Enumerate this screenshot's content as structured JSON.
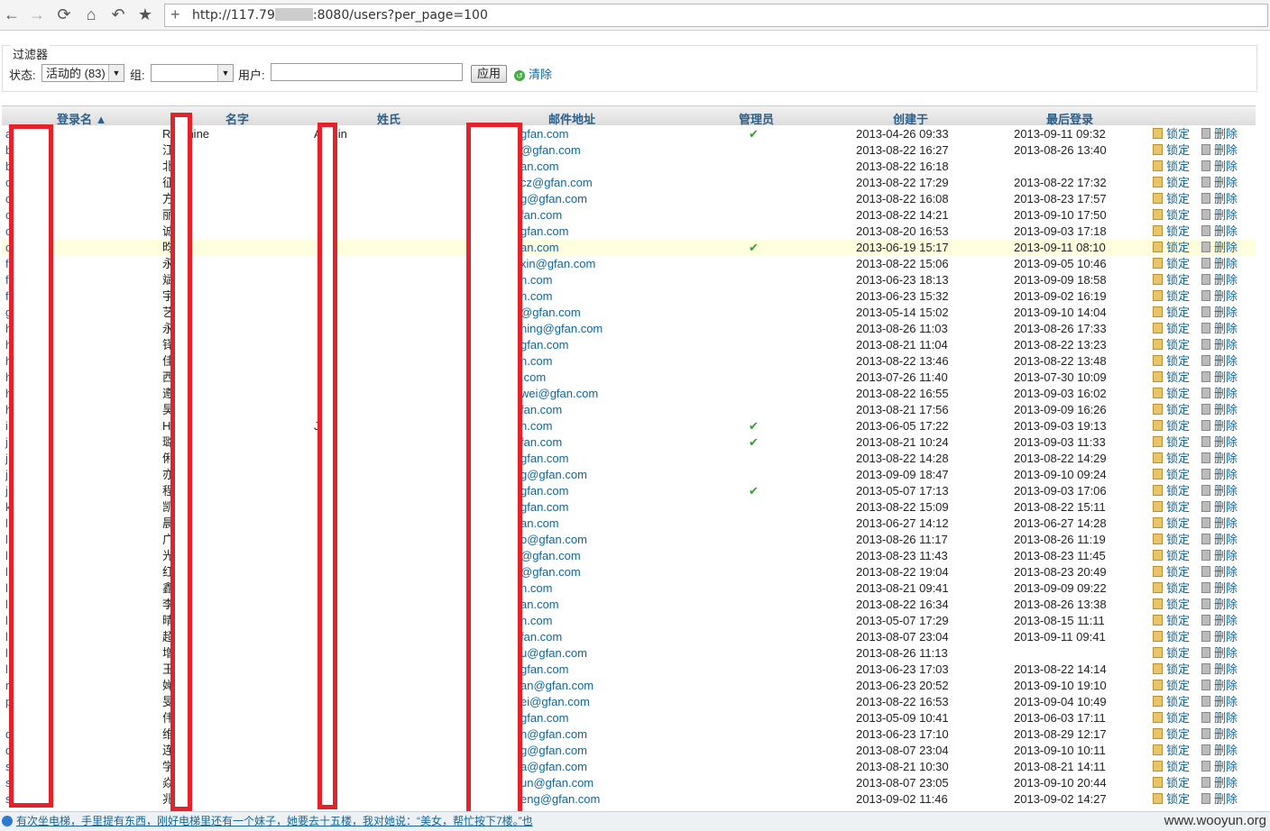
{
  "browser": {
    "url_prefix": "http://117.79",
    "url_suffix": ":8080/users?per_page=100",
    "new_tab": "+",
    "back_icon": "←",
    "forward_icon": "→",
    "reload_icon": "⟳",
    "home_icon": "⌂",
    "undo_icon": "↶",
    "star_icon": "★"
  },
  "filters": {
    "legend": "过滤器",
    "status_label": "状态:",
    "status_value": "活动的 (83)",
    "group_label": "组:",
    "group_value": "",
    "user_label": "用户:",
    "apply": "应用",
    "clear": "清除"
  },
  "table": {
    "headers": [
      "登录名 ▲",
      "名字",
      "姓氏",
      "邮件地址",
      "管理员",
      "创建于",
      "最后登录"
    ],
    "lock_label": "锁定",
    "delete_label": "删除",
    "rows": [
      {
        "login": "a",
        "name": "Redmine",
        "last": "Admin",
        "mail": "gfan.com",
        "admin": "✔",
        "created": "2013-04-26 09:33",
        "lastlog": "2013-09-11 09:32"
      },
      {
        "login": "b",
        "name": "江",
        "last": "",
        "mail": "@gfan.com",
        "admin": "",
        "created": "2013-08-22 16:27",
        "lastlog": "2013-08-26 13:40"
      },
      {
        "login": "b",
        "name": "北",
        "last": "",
        "mail": "an.com",
        "admin": "",
        "created": "2013-08-22 16:18",
        "lastlog": ""
      },
      {
        "login": "c",
        "name": "征",
        "last": "",
        "mail": "cz@gfan.com",
        "admin": "",
        "created": "2013-08-22 17:29",
        "lastlog": "2013-08-22 17:32"
      },
      {
        "login": "c",
        "name": "方",
        "last": "",
        "mail": "g@gfan.com",
        "admin": "",
        "created": "2013-08-22 16:08",
        "lastlog": "2013-08-23 17:57"
      },
      {
        "login": "c",
        "name": "丽",
        "last": "",
        "mail": "fan.com",
        "admin": "",
        "created": "2013-08-22 14:21",
        "lastlog": "2013-09-10 17:50"
      },
      {
        "login": "c",
        "name": "诚",
        "last": "",
        "mail": "gfan.com",
        "admin": "",
        "created": "2013-08-20 16:53",
        "lastlog": "2013-09-03 17:18"
      },
      {
        "login": "c",
        "name": "昀",
        "last": "",
        "mail": "an.com",
        "admin": "✔",
        "created": "2013-06-19 15:17",
        "lastlog": "2013-09-11 08:10"
      },
      {
        "login": "f",
        "name": "永",
        "last": "",
        "mail": "xin@gfan.com",
        "admin": "",
        "created": "2013-08-22 15:06",
        "lastlog": "2013-09-05 10:46"
      },
      {
        "login": "f",
        "name": "斌",
        "last": "",
        "mail": "n.com",
        "admin": "",
        "created": "2013-06-23 18:13",
        "lastlog": "2013-09-09 18:58"
      },
      {
        "login": "f",
        "name": "宇",
        "last": "",
        "mail": "n.com",
        "admin": "",
        "created": "2013-06-23 15:32",
        "lastlog": "2013-09-02 16:19"
      },
      {
        "login": "g",
        "name": "艺",
        "last": "",
        "mail": "@gfan.com",
        "admin": "",
        "created": "2013-05-14 15:02",
        "lastlog": "2013-09-10 14:04"
      },
      {
        "login": "h",
        "name": "永",
        "last": "",
        "mail": "ning@gfan.com",
        "admin": "",
        "created": "2013-08-26 11:03",
        "lastlog": "2013-08-26 17:33"
      },
      {
        "login": "h",
        "name": "铎",
        "last": "",
        "mail": "gfan.com",
        "admin": "",
        "created": "2013-08-21 11:04",
        "lastlog": "2013-08-22 13:23"
      },
      {
        "login": "h",
        "name": "佳",
        "last": "",
        "mail": "n.com",
        "admin": "",
        "created": "2013-08-22 13:46",
        "lastlog": "2013-08-22 13:48"
      },
      {
        "login": "h",
        "name": "西",
        "last": "",
        "mail": ".com",
        "admin": "",
        "created": "2013-07-26 11:40",
        "lastlog": "2013-07-30 10:09"
      },
      {
        "login": "h",
        "name": "遵",
        "last": "",
        "mail": "wei@gfan.com",
        "admin": "",
        "created": "2013-08-22 16:55",
        "lastlog": "2013-09-03 16:02"
      },
      {
        "login": "h",
        "name": "昊",
        "last": "",
        "mail": "fan.com",
        "admin": "",
        "created": "2013-08-21 17:56",
        "lastlog": "2013-09-09 16:26"
      },
      {
        "login": "i",
        "name": "Hang",
        "last": "Jac",
        "mail": "n.com",
        "admin": "✔",
        "created": "2013-06-05 17:22",
        "lastlog": "2013-09-03 19:13"
      },
      {
        "login": "j",
        "name": "璐",
        "last": "",
        "mail": "fan.com",
        "admin": "✔",
        "created": "2013-08-21 10:24",
        "lastlog": "2013-09-03 11:33"
      },
      {
        "login": "j",
        "name": "俐",
        "last": "",
        "mail": "gfan.com",
        "admin": "",
        "created": "2013-08-22 14:28",
        "lastlog": "2013-08-22 14:29"
      },
      {
        "login": "j",
        "name": "亦",
        "last": "",
        "mail": "g@gfan.com",
        "admin": "",
        "created": "2013-09-09 18:47",
        "lastlog": "2013-09-10 09:24"
      },
      {
        "login": "j",
        "name": "程",
        "last": "",
        "mail": "gfan.com",
        "admin": "✔",
        "created": "2013-05-07 17:13",
        "lastlog": "2013-09-03 17:06"
      },
      {
        "login": "k",
        "name": "凯",
        "last": "",
        "mail": "gfan.com",
        "admin": "",
        "created": "2013-08-22 15:09",
        "lastlog": "2013-08-22 15:11"
      },
      {
        "login": "l",
        "name": "晨",
        "last": "",
        "mail": "an.com",
        "admin": "",
        "created": "2013-06-27 14:12",
        "lastlog": "2013-06-27 14:28"
      },
      {
        "login": "l",
        "name": "广",
        "last": "",
        "mail": "o@gfan.com",
        "admin": "",
        "created": "2013-08-26 11:17",
        "lastlog": "2013-08-26 11:19"
      },
      {
        "login": "l",
        "name": "光",
        "last": "",
        "mail": "@gfan.com",
        "admin": "",
        "created": "2013-08-23 11:43",
        "lastlog": "2013-08-23 11:45"
      },
      {
        "login": "l",
        "name": "红",
        "last": "",
        "mail": "@gfan.com",
        "admin": "",
        "created": "2013-08-22 19:04",
        "lastlog": "2013-08-23 20:49"
      },
      {
        "login": "l",
        "name": "鑫",
        "last": "",
        "mail": "n.com",
        "admin": "",
        "created": "2013-08-21 09:41",
        "lastlog": "2013-09-09 09:22"
      },
      {
        "login": "l",
        "name": "李",
        "last": "",
        "mail": "an.com",
        "admin": "",
        "created": "2013-08-22 16:34",
        "lastlog": "2013-08-26 13:38"
      },
      {
        "login": "l",
        "name": "晴",
        "last": "",
        "mail": "n.com",
        "admin": "",
        "created": "2013-05-07 17:29",
        "lastlog": "2013-08-15 11:11"
      },
      {
        "login": "l",
        "name": "超",
        "last": "",
        "mail": "fan.com",
        "admin": "",
        "created": "2013-08-07 23:04",
        "lastlog": "2013-09-11 09:41"
      },
      {
        "login": "l",
        "name": "增",
        "last": "",
        "mail": "u@gfan.com",
        "admin": "",
        "created": "2013-08-26 11:13",
        "lastlog": ""
      },
      {
        "login": "l",
        "name": "玉",
        "last": "",
        "mail": "gfan.com",
        "admin": "",
        "created": "2013-06-23 17:03",
        "lastlog": "2013-08-22 14:14"
      },
      {
        "login": "m",
        "name": "婵",
        "last": "",
        "mail": "an@gfan.com",
        "admin": "",
        "created": "2013-06-23 20:52",
        "lastlog": "2013-09-10 19:10"
      },
      {
        "login": "p",
        "name": "旻",
        "last": "",
        "mail": "ei@gfan.com",
        "admin": "",
        "created": "2013-08-22 16:53",
        "lastlog": "2013-09-04 10:49"
      },
      {
        "login": "",
        "name": "伟",
        "last": "",
        "mail": "gfan.com",
        "admin": "",
        "created": "2013-05-09 10:41",
        "lastlog": "2013-06-03 17:11"
      },
      {
        "login": "q",
        "name": "维",
        "last": "",
        "mail": "n@gfan.com",
        "admin": "",
        "created": "2013-06-23 17:10",
        "lastlog": "2013-08-29 12:17"
      },
      {
        "login": "q",
        "name": "连",
        "last": "",
        "mail": "g@gfan.com",
        "admin": "",
        "created": "2013-08-07 23:04",
        "lastlog": "2013-09-10 10:11"
      },
      {
        "login": "s",
        "name": "学",
        "last": "",
        "mail": "a@gfan.com",
        "admin": "",
        "created": "2013-08-21 10:30",
        "lastlog": "2013-08-21 14:11"
      },
      {
        "login": "s",
        "name": "焱",
        "last": "",
        "mail": "un@gfan.com",
        "admin": "",
        "created": "2013-08-07 23:05",
        "lastlog": "2013-09-10 20:44"
      },
      {
        "login": "s",
        "name": "兆",
        "last": "",
        "mail": "eng@gfan.com",
        "admin": "",
        "created": "2013-09-02 11:46",
        "lastlog": "2013-09-02 14:27"
      }
    ]
  },
  "status_bar": {
    "message": "有次坐电梯，手里提有东西，刚好电梯里还有一个妹子，她要去十五楼，我对她说：“美女，帮忙按下7楼。”也",
    "watermark": "www.wooyun.org"
  }
}
